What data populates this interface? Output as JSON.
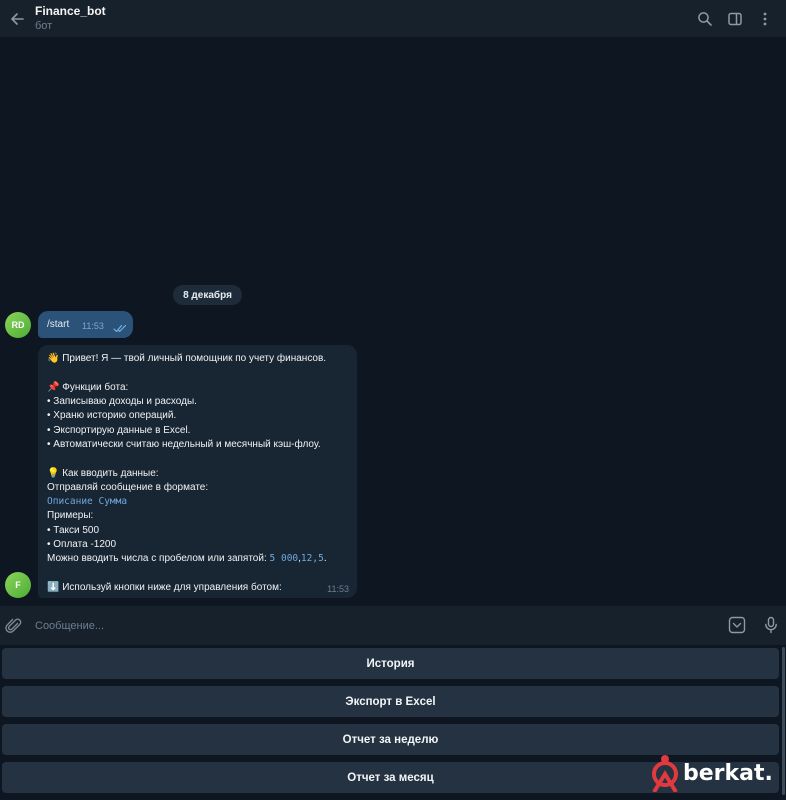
{
  "header": {
    "title": "Finance_bot",
    "subtitle": "бот",
    "icons": [
      "back-arrow-icon",
      "search-icon",
      "sidebar-panel-icon",
      "more-vertical-icon"
    ]
  },
  "chat": {
    "date_separator": "8 декабря",
    "outgoing": {
      "avatar_initials": "RD",
      "text": "/start",
      "time": "11:53",
      "status": "read"
    },
    "incoming": {
      "avatar_initials": "F",
      "time": "11:53",
      "lines": {
        "greeting_emoji": "👋",
        "greeting": "Привет! Я — твой личный помощник по учету финансов.",
        "functions_emoji": "📌",
        "functions_title": "Функции бота:",
        "f1": "• Записываю доходы и расходы.",
        "f2": "• Храню историю операций.",
        "f3": "• Экспортирую данные в Excel.",
        "f4": "• Автоматически считаю недельный и месячный кэш-флоу.",
        "howto_emoji": "💡",
        "howto_title": "Как вводить данные:",
        "format_intro": "Отправляй сообщение в формате:",
        "format_code": "Описание Сумма",
        "examples_title": "Примеры:",
        "ex1": "• Такси 500",
        "ex2": "• Оплата -1200",
        "numbers_text": "Можно вводить числа с пробелом или запятой:",
        "numbers_code1": "5 000",
        "numbers_sep": ",",
        "numbers_code2": "12,5",
        "numbers_end": ".",
        "footer_emoji": "⬇️",
        "footer": "Используй кнопки ниже для управления ботом:"
      }
    }
  },
  "composer": {
    "placeholder": "Сообщение..."
  },
  "keyboard": {
    "buttons": [
      "История",
      "Экспорт в Excel",
      "Отчет за неделю",
      "Отчет за месяц"
    ]
  },
  "watermark": {
    "text": "berkat."
  },
  "colors": {
    "background": "#0e1621",
    "header": "#17212b",
    "outgoing_bubble": "#2b5278",
    "incoming_bubble": "#182533",
    "keyboard_button": "#243241",
    "code_text": "#6fa8dc",
    "watermark_accent": "#e03a3e"
  }
}
